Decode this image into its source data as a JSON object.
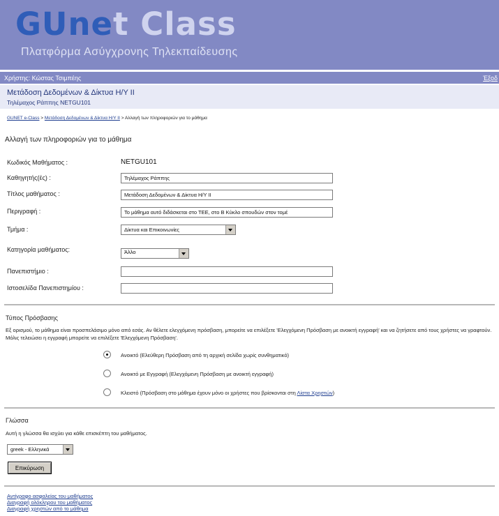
{
  "header": {
    "logo_part1": "GUne",
    "logo_part2": "t",
    "logo_part3": " Class",
    "subtitle": "Πλατφόρμα Ασύγχρονης Τηλεκπαίδευσης"
  },
  "userbar": {
    "user": "Χρήστης: Κώστας Τσιμπέης",
    "logout": "Έξοδ"
  },
  "course": {
    "title": "Μετάδοση Δεδομένων & Δίκτυα Η/Υ ΙΙ",
    "info": "Τηλέμαχος Ράππης NETGU101"
  },
  "breadcrumb": {
    "item1": "GUNET e-Class",
    "item2": "Μετάδοση Δεδομένων & Δίκτυα Η/Υ ΙΙ",
    "item3": "Αλλαγή των πληροφοριών για το μάθημα",
    "sep": " > "
  },
  "page_title": "Αλλαγή των πληροφοριών για το μάθημα",
  "form": {
    "code_label": "Κωδικός Μαθήματος :",
    "code_value": "NETGU101",
    "instructor_label": "Καθηγητής(ές) :",
    "instructor_value": "Τηλέμαχος Ράππης",
    "course_title_label": "Τίτλος μαθήματος :",
    "course_title_value": "Μετάδοση Δεδομένων & Δίκτυα Η/Υ ΙΙ",
    "description_label": "Περιγραφή :",
    "description_value": "Το μάθημα αυτό διδάσκεται στο ΤΕΕ, στο Β Κύκλο σπουδών στον τομέ",
    "department_label": "Τμήμα :",
    "department_value": "Δίκτυα και Επικοινωνίες",
    "category_label": "Κατηγορία μαθήματος:",
    "category_value": "Άλλο",
    "university_label": "Πανεπιστήμιο :",
    "university_value": "",
    "website_label": "Ιστοσελίδα Πανεπιστημίου :",
    "website_value": ""
  },
  "access": {
    "title": "Τύπος Πρόσβασης",
    "description": "Εξ ορισμού, το μάθημα είναι προσπελάσιμο μόνο από εσάς. Αν θέλετε ελεγχόμενη πρόσβαση, μπορείτε να επιλέξετε 'Ελεγχόμενη Πρόσβαση με ανοικτή εγγραφή' και να ζητήσετε από τους χρήστες να γραφτούν. Μόλις τελειώσει η εγγραφή μπορείτε να επιλέξετε 'Ελεγχόμενη Πρόσβαση'.",
    "options": [
      {
        "label": "Ανοικτό (Ελεύθερη Πρόσβαση από τη αρχική σελίδα χωρίς συνθηματικό)",
        "selected": true
      },
      {
        "label": "Ανοικτό με Εγγραφή (Ελεγχόμενη Πρόσβαση με ανοικτή εγγραφή)",
        "selected": false
      },
      {
        "label": "Κλειστό (Πρόσβαση στο μάθημα έχουν μόνο οι χρήστες που βρίσκονται στη ",
        "selected": false,
        "link": "Λίστα Χρηστών",
        "suffix": ")"
      }
    ]
  },
  "language": {
    "title": "Γλώσσα",
    "description": "Αυτή η γλώσσα θα ισχύει για κάθε επισκέπτη του μαθήματος.",
    "selected": "greek - Ελληνικά"
  },
  "submit_label": "Επικύρωση",
  "footer_links": [
    "Αντίγραφο ασφαλείας του μαθήματος",
    "Διαγραφή ολόκληρου του μαθήματος",
    "Διαγραφή χρηστών από το μάθημα"
  ],
  "colors": {
    "banner": "#8289c4",
    "logo_blue": "#2f5db8",
    "course_bar": "#e8eaf6",
    "link": "#1d3c8f"
  }
}
